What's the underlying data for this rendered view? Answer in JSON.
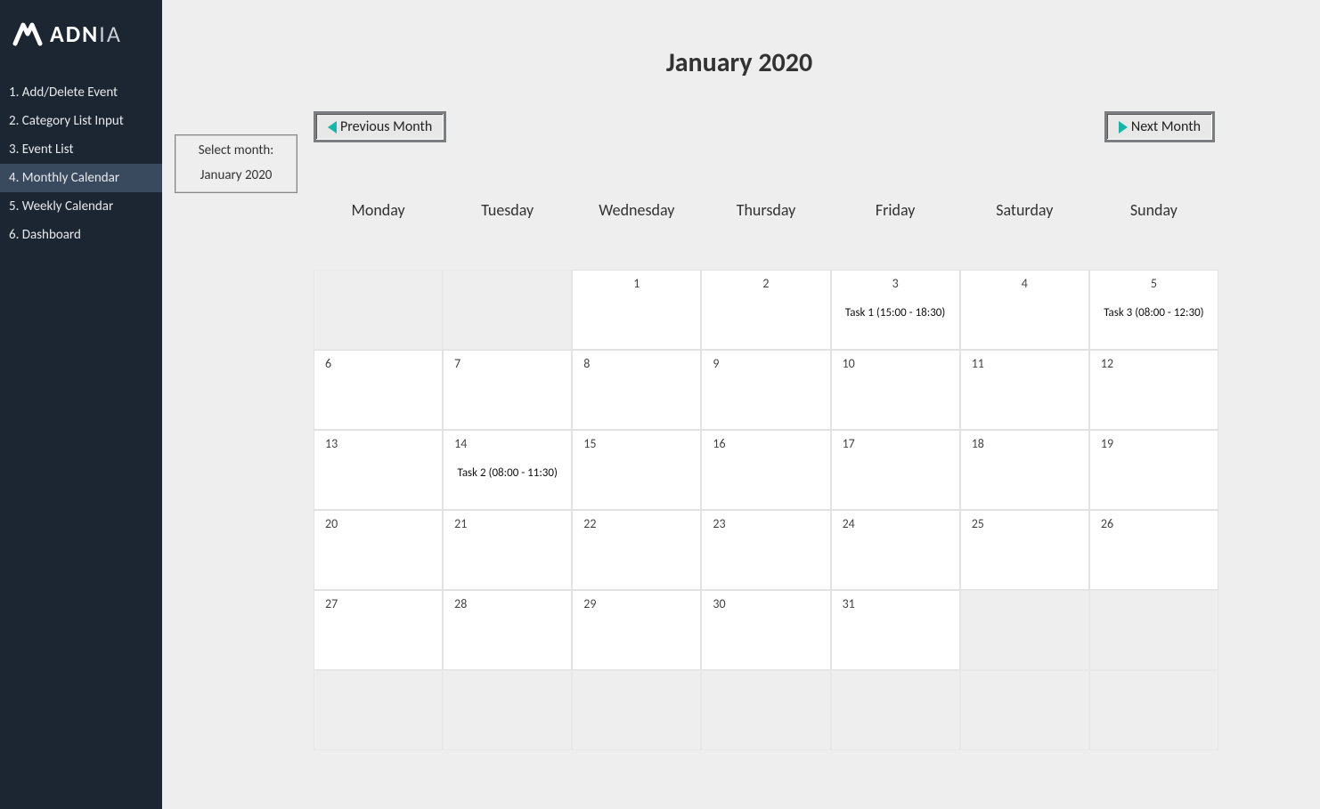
{
  "brand": {
    "name_bold": "ADN",
    "name_thin": "IA"
  },
  "sidebar": {
    "items": [
      {
        "label": "1. Add/Delete Event",
        "active": false
      },
      {
        "label": "2. Category List Input",
        "active": false
      },
      {
        "label": "3. Event List",
        "active": false
      },
      {
        "label": "4. Monthly Calendar",
        "active": true
      },
      {
        "label": "5. Weekly Calendar",
        "active": false
      },
      {
        "label": "6. Dashboard",
        "active": false
      }
    ]
  },
  "header": {
    "title": "January 2020",
    "prev_label": "Previous Month",
    "next_label": "Next Month",
    "select_label": "Select month:",
    "select_value": "January 2020"
  },
  "calendar": {
    "days_of_week": [
      "Monday",
      "Tuesday",
      "Wednesday",
      "Thursday",
      "Friday",
      "Saturday",
      "Sunday"
    ],
    "weeks": [
      [
        {
          "n": "",
          "blank": true,
          "event": ""
        },
        {
          "n": "",
          "blank": true,
          "event": ""
        },
        {
          "n": "1",
          "blank": false,
          "event": ""
        },
        {
          "n": "2",
          "blank": false,
          "event": ""
        },
        {
          "n": "3",
          "blank": false,
          "event": "Task 1 (15:00 - 18:30)"
        },
        {
          "n": "4",
          "blank": false,
          "event": ""
        },
        {
          "n": "5",
          "blank": false,
          "event": "Task 3 (08:00 - 12:30)"
        }
      ],
      [
        {
          "n": "6",
          "blank": false,
          "event": ""
        },
        {
          "n": "7",
          "blank": false,
          "event": ""
        },
        {
          "n": "8",
          "blank": false,
          "event": ""
        },
        {
          "n": "9",
          "blank": false,
          "event": ""
        },
        {
          "n": "10",
          "blank": false,
          "event": ""
        },
        {
          "n": "11",
          "blank": false,
          "event": ""
        },
        {
          "n": "12",
          "blank": false,
          "event": ""
        }
      ],
      [
        {
          "n": "13",
          "blank": false,
          "event": ""
        },
        {
          "n": "14",
          "blank": false,
          "event": "Task 2 (08:00 - 11:30)"
        },
        {
          "n": "15",
          "blank": false,
          "event": ""
        },
        {
          "n": "16",
          "blank": false,
          "event": ""
        },
        {
          "n": "17",
          "blank": false,
          "event": ""
        },
        {
          "n": "18",
          "blank": false,
          "event": ""
        },
        {
          "n": "19",
          "blank": false,
          "event": ""
        }
      ],
      [
        {
          "n": "20",
          "blank": false,
          "event": ""
        },
        {
          "n": "21",
          "blank": false,
          "event": ""
        },
        {
          "n": "22",
          "blank": false,
          "event": ""
        },
        {
          "n": "23",
          "blank": false,
          "event": ""
        },
        {
          "n": "24",
          "blank": false,
          "event": ""
        },
        {
          "n": "25",
          "blank": false,
          "event": ""
        },
        {
          "n": "26",
          "blank": false,
          "event": ""
        }
      ],
      [
        {
          "n": "27",
          "blank": false,
          "event": ""
        },
        {
          "n": "28",
          "blank": false,
          "event": ""
        },
        {
          "n": "29",
          "blank": false,
          "event": ""
        },
        {
          "n": "30",
          "blank": false,
          "event": ""
        },
        {
          "n": "31",
          "blank": false,
          "event": ""
        },
        {
          "n": "",
          "blank": true,
          "event": ""
        },
        {
          "n": "",
          "blank": true,
          "event": ""
        }
      ],
      [
        {
          "n": "",
          "blank": true,
          "event": ""
        },
        {
          "n": "",
          "blank": true,
          "event": ""
        },
        {
          "n": "",
          "blank": true,
          "event": ""
        },
        {
          "n": "",
          "blank": true,
          "event": ""
        },
        {
          "n": "",
          "blank": true,
          "event": ""
        },
        {
          "n": "",
          "blank": true,
          "event": ""
        },
        {
          "n": "",
          "blank": true,
          "event": ""
        }
      ]
    ]
  }
}
